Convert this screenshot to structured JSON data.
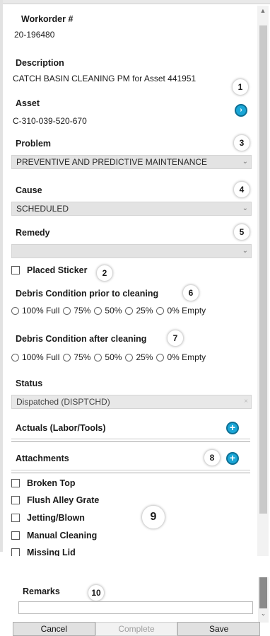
{
  "workorder": {
    "label": "Workorder #",
    "value": "20-196480"
  },
  "description": {
    "label": "Description",
    "value": "CATCH BASIN CLEANING PM for Asset 441951"
  },
  "asset": {
    "label": "Asset",
    "value": "C-310-039-520-670"
  },
  "problem": {
    "label": "Problem",
    "value": "PREVENTIVE AND PREDICTIVE MAINTENANCE"
  },
  "cause": {
    "label": "Cause",
    "value": "SCHEDULED"
  },
  "remedy": {
    "label": "Remedy",
    "value": ""
  },
  "placed_sticker": {
    "label": "Placed Sticker",
    "checked": false
  },
  "debris_prior": {
    "label": "Debris Condition prior to cleaning",
    "options": [
      "100% Full",
      "75%",
      "50%",
      "25%",
      "0% Empty"
    ]
  },
  "debris_after": {
    "label": "Debris Condition after cleaning",
    "options": [
      "100% Full",
      "75%",
      "50%",
      "25%",
      "0% Empty"
    ]
  },
  "status": {
    "label": "Status",
    "value": "Dispatched (DISPTCHD)"
  },
  "actuals": {
    "label": "Actuals (Labor/Tools)"
  },
  "attachments": {
    "label": "Attachments"
  },
  "checklist": [
    "Broken Top",
    "Flush Alley Grate",
    "Jetting/Blown",
    "Manual Cleaning",
    "Missing Lid"
  ],
  "remarks": {
    "label": "Remarks",
    "value": ""
  },
  "buttons": {
    "cancel": "Cancel",
    "complete": "Complete",
    "save": "Save"
  },
  "badges": [
    "1",
    "2",
    "3",
    "4",
    "5",
    "6",
    "7",
    "8",
    "9",
    "10"
  ],
  "colors": {
    "accent": "#1aa6d6",
    "dropdown_bg": "#e3e3e3"
  },
  "icons": [
    "asset-lookup-icon",
    "add-actuals-icon",
    "add-attachment-icon",
    "chevron-down-icon"
  ]
}
